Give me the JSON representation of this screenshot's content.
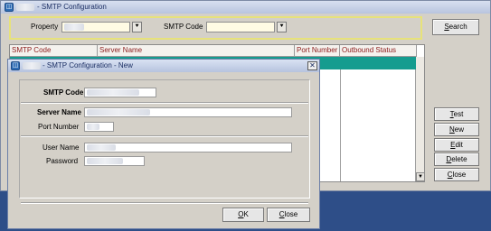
{
  "window": {
    "title": "- SMTP Configuration"
  },
  "filters": {
    "property_label": "Property",
    "smtp_code_label": "SMTP Code",
    "dropdown_glyph": "⯆"
  },
  "grid": {
    "columns": [
      "SMTP Code",
      "Server Name",
      "Port Number",
      "Outbound Status"
    ],
    "selected_row": 0
  },
  "buttons": {
    "search": {
      "key": "S",
      "rest": "earch"
    },
    "test": {
      "key": "T",
      "rest": "est"
    },
    "new": {
      "key": "N",
      "rest": "ew"
    },
    "edit": {
      "key": "E",
      "rest": "dit"
    },
    "delete": {
      "key": "D",
      "rest": "elete"
    },
    "close": {
      "key": "C",
      "rest": "lose"
    }
  },
  "dialog": {
    "title": "- SMTP Configuration - New",
    "close_glyph": "✕",
    "fields": {
      "smtp_code": "SMTP Code",
      "server_name": "Server Name",
      "port_number": "Port Number",
      "user_name": "User Name",
      "password": "Password"
    },
    "ok": {
      "key": "O",
      "rest": "K"
    },
    "close": {
      "key": "C",
      "rest": "lose"
    }
  },
  "icons": {
    "app": "app-icon",
    "dropdown": "dropdown-arrow-icon",
    "close": "close-icon"
  },
  "colors": {
    "selected_row": "#159c8f",
    "header_text": "#8b1a1a",
    "filter_border": "#e7e27a",
    "field_bg": "#fffbe4"
  }
}
